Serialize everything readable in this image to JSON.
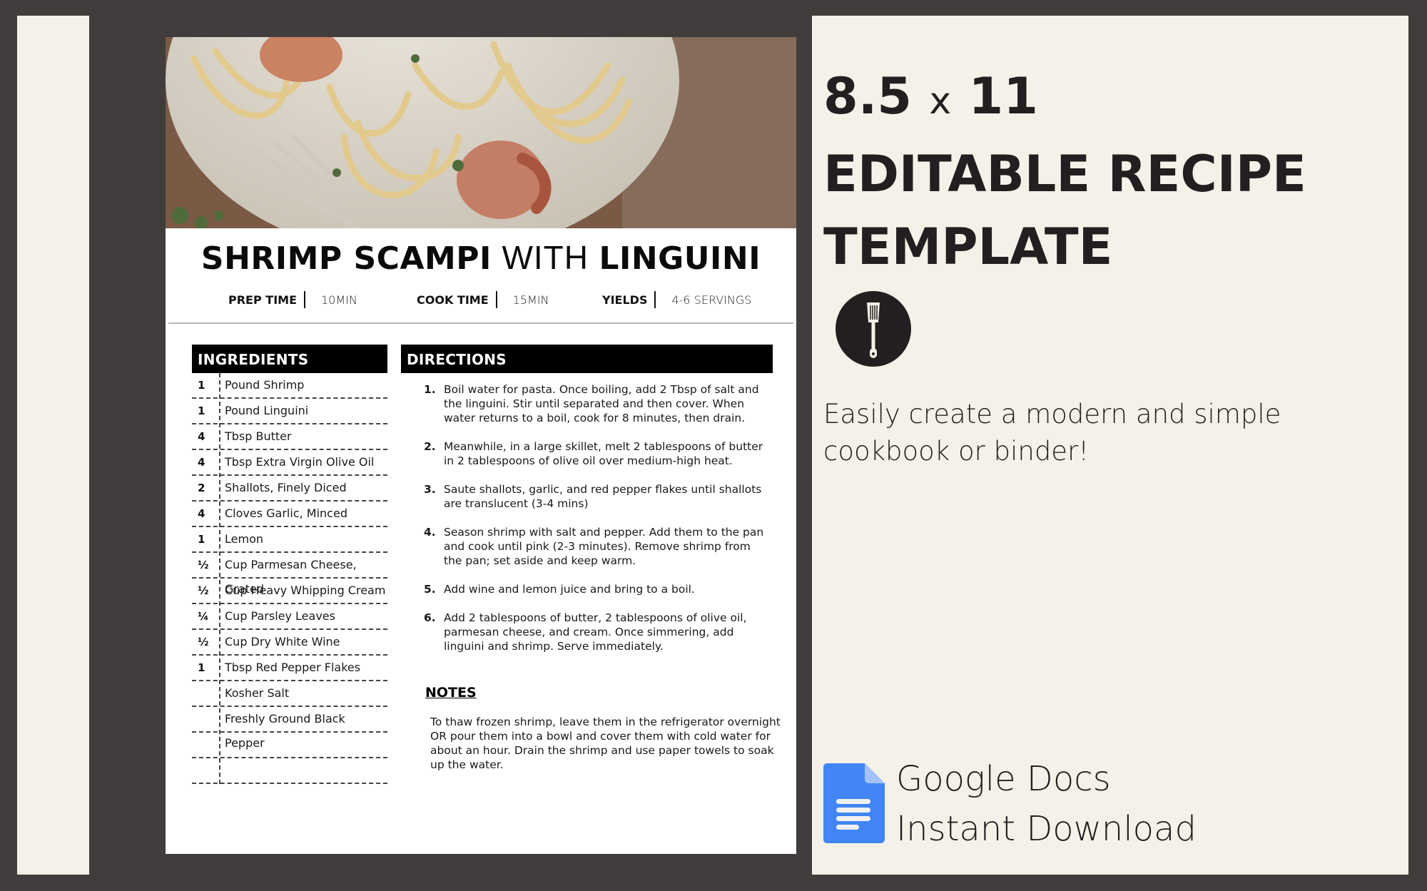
{
  "recipe": {
    "title_bold_1": "SHRIMP SCAMPI",
    "title_light": "WITH",
    "title_bold_2": "LINGUINI",
    "photo_alt": "Shrimp scampi with linguini on a white plate with a fork",
    "meta": [
      {
        "label": "PREP TIME",
        "value": "10MIN"
      },
      {
        "label": "COOK TIME",
        "value": "15MIN"
      },
      {
        "label": "YIELDS",
        "value": "4-6 SERVINGS"
      }
    ],
    "ingredients_header": "INGREDIENTS",
    "ingredients": [
      {
        "qty": "1",
        "name": "Pound Shrimp"
      },
      {
        "qty": "1",
        "name": "Pound Linguini"
      },
      {
        "qty": "4",
        "name": "Tbsp Butter"
      },
      {
        "qty": "4",
        "name": "Tbsp Extra Virgin Olive Oil"
      },
      {
        "qty": "2",
        "name": "Shallots, Finely Diced"
      },
      {
        "qty": "4",
        "name": "Cloves Garlic, Minced"
      },
      {
        "qty": "1",
        "name": "Lemon"
      },
      {
        "qty": "½",
        "name": "Cup Parmesan Cheese, Grated"
      },
      {
        "qty": "½",
        "name": "Cup Heavy Whipping Cream"
      },
      {
        "qty": "¼",
        "name": "Cup Parsley Leaves"
      },
      {
        "qty": "½",
        "name": "Cup Dry White Wine"
      },
      {
        "qty": "1",
        "name": "Tbsp Red Pepper Flakes"
      },
      {
        "qty": "",
        "name": "Kosher Salt"
      },
      {
        "qty": "",
        "name": "Freshly Ground Black Pepper"
      },
      {
        "qty": "",
        "name": ""
      },
      {
        "qty": "",
        "name": ""
      }
    ],
    "directions_header": "DIRECTIONS",
    "directions": [
      {
        "num": "1.",
        "text": "Boil water for pasta. Once boiling, add 2 Tbsp of salt and the linguini. Stir until separated and then cover. When water returns to a boil, cook for 8 minutes, then drain."
      },
      {
        "num": "2.",
        "text": "Meanwhile, in a large skillet, melt 2 tablespoons of butter in 2 tablespoons of olive oil over medium-high heat."
      },
      {
        "num": "3.",
        "text": "Saute shallots, garlic, and red pepper flakes until shallots are translucent (3-4 mins)"
      },
      {
        "num": "4.",
        "text": "Season shrimp with salt and pepper. Add them to the pan and cook until pink (2-3 minutes). Remove shrimp from the pan; set aside and keep warm."
      },
      {
        "num": "5.",
        "text": "Add wine and lemon juice and bring to a boil."
      },
      {
        "num": "6.",
        "text": "Add 2 tablespoons of butter, 2 tablespoons of olive oil, parmesan cheese, and cream. Once simmering, add linguini and shrimp. Serve immediately."
      }
    ],
    "notes_title": "NOTES",
    "notes_body": "To thaw frozen shrimp, leave them in the refrigerator overnight OR pour them into a bowl and cover them with cold water for about an hour. Drain the shrimp and use paper towels to soak up the water."
  },
  "promo": {
    "size_a": "8.5",
    "size_x": "x",
    "size_b": "11",
    "line2": "EDITABLE RECIPE",
    "line3": "TEMPLATE",
    "icon": "spatula-icon",
    "tagline": "Easily create a modern and simple cookbook or binder!",
    "app_icon": "google-docs-icon",
    "app_name": "Google Docs",
    "download": "Instant Download"
  },
  "colors": {
    "background": "#413d3c",
    "panel": "#f4f2e8",
    "text_dark": "#231f20",
    "docs_blue": "#4285f4"
  }
}
